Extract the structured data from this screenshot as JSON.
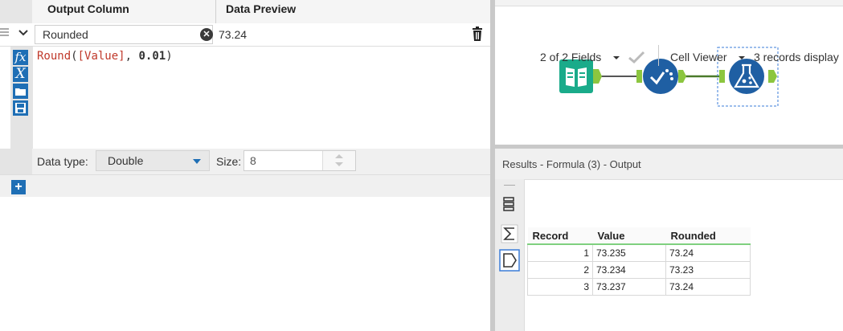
{
  "formula_panel": {
    "headers": {
      "output_column": "Output Column",
      "data_preview": "Data Preview"
    },
    "expression_row": {
      "output_column_value": "Rounded",
      "preview_value": "73.24"
    },
    "expression": {
      "func": "Round",
      "open": "(",
      "field": "[Value]",
      "sep": ", ",
      "arg": "0.01",
      "close": ")"
    },
    "tool_icons": [
      "fx-icon",
      "variable-x-icon",
      "open-folder-icon",
      "save-icon"
    ],
    "data_type": {
      "label": "Data type:",
      "value": "Double"
    },
    "size": {
      "label": "Size:",
      "value": "8"
    },
    "add_label": "+"
  },
  "canvas": {
    "tools": [
      "input-data-tool-icon",
      "select-tool-icon",
      "formula-tool-icon"
    ],
    "colors": {
      "input": "#1aab8a",
      "select": "#1f5fa3",
      "formula": "#1f5fa3",
      "connector": "#8cc63f"
    }
  },
  "results": {
    "title": "Results - Formula (3) - Output",
    "fields_selector": "2 of 2 Fields",
    "cell_viewer": "Cell Viewer",
    "records_text": "3 records display",
    "columns": [
      "Record",
      "Value",
      "Rounded"
    ],
    "rows": [
      {
        "record": "1",
        "value": "73.235",
        "rounded": "73.24"
      },
      {
        "record": "2",
        "value": "73.234",
        "rounded": "73.23"
      },
      {
        "record": "3",
        "value": "73.237",
        "rounded": "73.24"
      }
    ]
  }
}
